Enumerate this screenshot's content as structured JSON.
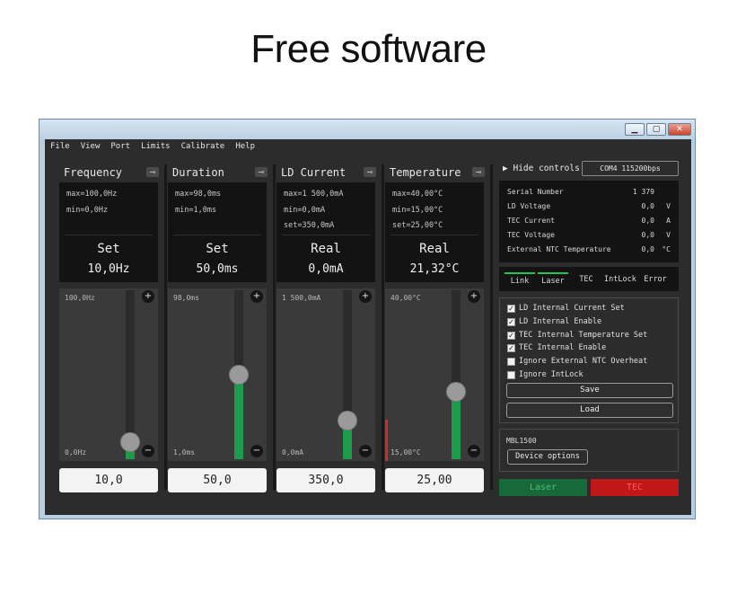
{
  "headline": "Free software",
  "window": {
    "buttons": [
      "▁",
      "▢",
      "✕"
    ],
    "menu": [
      "File",
      "View",
      "Port",
      "Limits",
      "Calibrate",
      "Help"
    ]
  },
  "panels": [
    {
      "title": "Frequency",
      "lines": [
        "max=100,0Hz",
        "min=0,0Hz"
      ],
      "mode": "Set",
      "reading": "10,0Hz",
      "top_limit": "100,0Hz",
      "bottom_limit": "0,0Hz",
      "slider_fraction": 0.1,
      "value": "10,0"
    },
    {
      "title": "Duration",
      "lines": [
        "max=98,0ms",
        "min=1,0ms"
      ],
      "mode": "Set",
      "reading": "50,0ms",
      "top_limit": "98,0ms",
      "bottom_limit": "1,0ms",
      "slider_fraction": 0.5,
      "value": "50,0"
    },
    {
      "title": "LD Current",
      "lines": [
        "max=1 500,0mA",
        "min=0,0mA",
        "set=350,0mA"
      ],
      "mode": "Real",
      "reading": "0,0mA",
      "top_limit": "1 500,0mA",
      "bottom_limit": "0,0mA",
      "slider_fraction": 0.23,
      "value": "350,0"
    },
    {
      "title": "Temperature",
      "lines": [
        "max=40,00°C",
        "min=15,00°C",
        "set=25,00°C"
      ],
      "mode": "Real",
      "reading": "21,32°C",
      "top_limit": "40,00°C",
      "bottom_limit": "15,00°C",
      "slider_fraction": 0.4,
      "value": "25,00"
    }
  ],
  "right": {
    "hide_controls": "Hide controls",
    "port": "COM4    115200bps",
    "status": [
      {
        "label": "Serial Number",
        "value": "1 379",
        "unit": ""
      },
      {
        "label": "LD Voltage",
        "value": "0,0",
        "unit": "V"
      },
      {
        "label": "TEC Current",
        "value": "0,0",
        "unit": "A"
      },
      {
        "label": "TEC Voltage",
        "value": "0,0",
        "unit": "V"
      },
      {
        "label": "External NTC Temperature",
        "value": "0,0",
        "unit": "°C"
      }
    ],
    "indicators": [
      {
        "label": "Link",
        "on": true
      },
      {
        "label": "Laser",
        "on": true
      },
      {
        "label": "TEC",
        "on": false
      },
      {
        "label": "IntLock",
        "on": false
      },
      {
        "label": "Error",
        "on": false
      }
    ],
    "checkboxes": [
      {
        "label": "LD Internal Current Set",
        "checked": true
      },
      {
        "label": "LD Internal Enable",
        "checked": true
      },
      {
        "label": "TEC Internal Temperature Set",
        "checked": true
      },
      {
        "label": "TEC Internal Enable",
        "checked": true
      },
      {
        "label": "Ignore External NTC Overheat",
        "checked": false
      },
      {
        "label": "Ignore IntLock",
        "checked": false
      }
    ],
    "save": "Save",
    "load": "Load",
    "device_name": "MBL1500",
    "device_options": "Device options",
    "laser_button": "Laser",
    "tec_button": "TEC",
    "colors": {
      "laser": "#17693a",
      "tec": "#c01818",
      "led_on": "#27c455"
    }
  }
}
